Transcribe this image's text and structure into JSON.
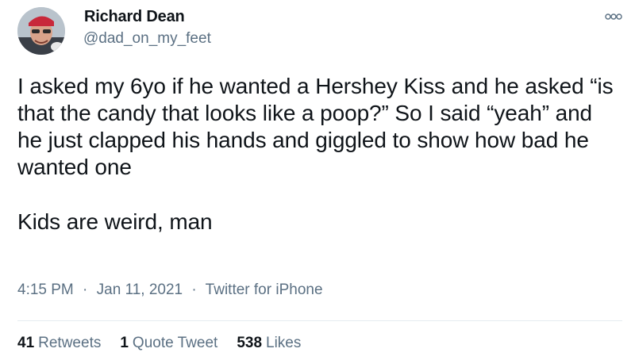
{
  "author": {
    "name": "Richard Dean",
    "handle": "@dad_on_my_feet",
    "avatar_icon": "profile-photo"
  },
  "tweet": {
    "paragraph1": "I asked my 6yo if he wanted a Hershey Kiss and he asked “is that the candy that looks like a poop?”  So I said “yeah” and he just clapped his hands and giggled to show how bad he wanted one",
    "paragraph2": "Kids are weird, man"
  },
  "meta": {
    "time": "4:15 PM",
    "separator": "·",
    "date": "Jan 11, 2021",
    "source": "Twitter for iPhone"
  },
  "stats": {
    "retweets_count": "41",
    "retweets_label": "Retweets",
    "quotes_count": "1",
    "quotes_label": "Quote Tweet",
    "likes_count": "538",
    "likes_label": "Likes"
  },
  "colors": {
    "text": "#0f1419",
    "secondary": "#5b7083",
    "divider": "#e6ecf0"
  }
}
